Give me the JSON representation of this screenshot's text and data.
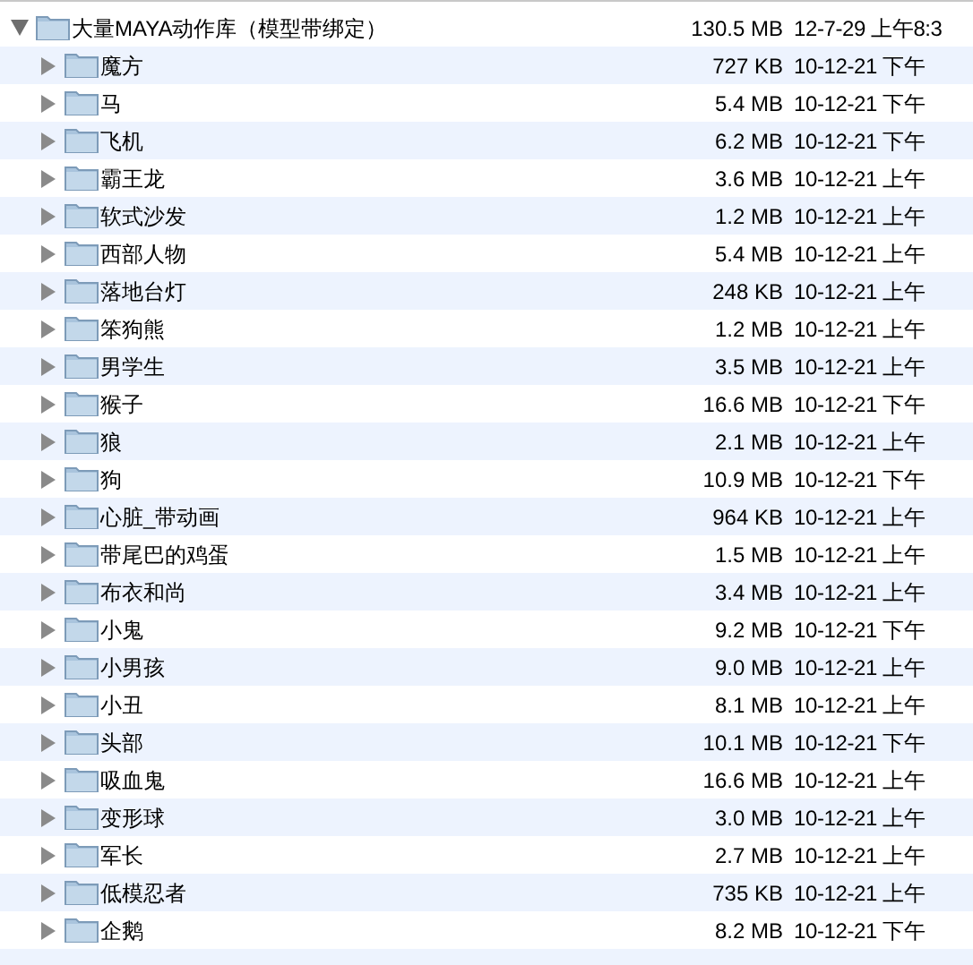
{
  "folder": {
    "name": "大量MAYA动作库（模型带绑定）",
    "size": "130.5 MB",
    "date": "12-7-29 上午8:3",
    "expanded": true,
    "children": [
      {
        "name": "魔方",
        "size": "727 KB",
        "date": "10-12-21 下午",
        "expanded": false
      },
      {
        "name": "马",
        "size": "5.4 MB",
        "date": "10-12-21 下午",
        "expanded": false
      },
      {
        "name": "飞机",
        "size": "6.2 MB",
        "date": "10-12-21 下午",
        "expanded": false
      },
      {
        "name": "霸王龙",
        "size": "3.6 MB",
        "date": "10-12-21 上午",
        "expanded": false
      },
      {
        "name": "软式沙发",
        "size": "1.2 MB",
        "date": "10-12-21 上午",
        "expanded": false
      },
      {
        "name": "西部人物",
        "size": "5.4 MB",
        "date": "10-12-21 上午",
        "expanded": false
      },
      {
        "name": "落地台灯",
        "size": "248 KB",
        "date": "10-12-21 上午",
        "expanded": false
      },
      {
        "name": "笨狗熊",
        "size": "1.2 MB",
        "date": "10-12-21 上午",
        "expanded": false
      },
      {
        "name": "男学生",
        "size": "3.5 MB",
        "date": "10-12-21 上午",
        "expanded": false
      },
      {
        "name": "猴子",
        "size": "16.6 MB",
        "date": "10-12-21 下午",
        "expanded": false
      },
      {
        "name": "狼",
        "size": "2.1 MB",
        "date": "10-12-21 上午",
        "expanded": false
      },
      {
        "name": "狗",
        "size": "10.9 MB",
        "date": "10-12-21 下午",
        "expanded": false
      },
      {
        "name": "心脏_带动画",
        "size": "964 KB",
        "date": "10-12-21 上午",
        "expanded": false
      },
      {
        "name": "带尾巴的鸡蛋",
        "size": "1.5 MB",
        "date": "10-12-21 上午",
        "expanded": false
      },
      {
        "name": "布衣和尚",
        "size": "3.4 MB",
        "date": "10-12-21 上午",
        "expanded": false
      },
      {
        "name": "小鬼",
        "size": "9.2 MB",
        "date": "10-12-21 下午",
        "expanded": false
      },
      {
        "name": "小男孩",
        "size": "9.0 MB",
        "date": "10-12-21 上午",
        "expanded": false
      },
      {
        "name": "小丑",
        "size": "8.1 MB",
        "date": "10-12-21 上午",
        "expanded": false
      },
      {
        "name": "头部",
        "size": "10.1 MB",
        "date": "10-12-21 下午",
        "expanded": false
      },
      {
        "name": "吸血鬼",
        "size": "16.6 MB",
        "date": "10-12-21 上午",
        "expanded": false
      },
      {
        "name": "变形球",
        "size": "3.0 MB",
        "date": "10-12-21 上午",
        "expanded": false
      },
      {
        "name": "军长",
        "size": "2.7 MB",
        "date": "10-12-21 上午",
        "expanded": false
      },
      {
        "name": "低模忍者",
        "size": "735 KB",
        "date": "10-12-21 上午",
        "expanded": false
      },
      {
        "name": "企鹅",
        "size": "8.2 MB",
        "date": "10-12-21 下午",
        "expanded": false
      }
    ]
  }
}
